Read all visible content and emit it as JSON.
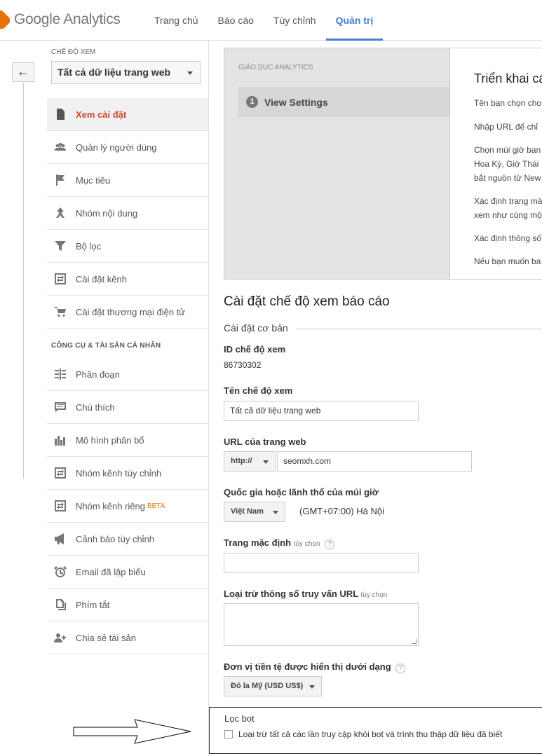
{
  "header": {
    "brand": "Google Analytics",
    "nav": [
      {
        "label": "Trang chủ",
        "active": false
      },
      {
        "label": "Báo cáo",
        "active": false
      },
      {
        "label": "Tùy chỉnh",
        "active": false
      },
      {
        "label": "Quản trị",
        "active": true
      }
    ]
  },
  "sidebar": {
    "view_label": "CHẾ ĐỘ XEM",
    "view_value": "Tất cả dữ liệu trang web",
    "items": [
      {
        "label": "Xem cài đặt",
        "icon": "document-icon",
        "active": true
      },
      {
        "label": "Quản lý người dùng",
        "icon": "users-icon"
      },
      {
        "label": "Mục tiêu",
        "icon": "flag-icon"
      },
      {
        "label": "Nhóm nội dung",
        "icon": "content-grouping-icon"
      },
      {
        "label": "Bộ lọc",
        "icon": "filter-icon"
      },
      {
        "label": "Cài đặt kênh",
        "icon": "channel-icon"
      },
      {
        "label": "Cài đặt thương mại điện tử",
        "icon": "cart-icon"
      }
    ],
    "section2_label": "CÔNG CỤ & TÀI SẢN CÁ NHÂN",
    "items2": [
      {
        "label": "Phân đoạn",
        "icon": "segments-icon"
      },
      {
        "label": "Chú thích",
        "icon": "annotation-icon"
      },
      {
        "label": "Mô hình phân bổ",
        "icon": "bar-chart-icon"
      },
      {
        "label": "Nhóm kênh tùy chỉnh",
        "icon": "channel-icon"
      },
      {
        "label": "Nhóm kênh riêng",
        "badge": "BETA",
        "icon": "channel-icon"
      },
      {
        "label": "Cảnh báo tùy chỉnh",
        "icon": "megaphone-icon"
      },
      {
        "label": "Email đã lập biểu",
        "icon": "alarm-clock-icon"
      },
      {
        "label": "Phím tắt",
        "icon": "copy-icon"
      },
      {
        "label": "Chia sẻ tài sản",
        "icon": "add-user-icon"
      }
    ]
  },
  "wizard": {
    "category": "GIÁO DỤC ANALYTICS",
    "step_number": "1",
    "step_label": "View Settings",
    "title": "Triển khai cá",
    "lines": [
      "Tên bạn chọn cho",
      "Nhập URL để chỉ",
      "Chọn múi giờ bạn",
      "Hoa Kỳ, Giờ Thái",
      "bắt nguồn từ New",
      "Xác định trang mà",
      "xem như cùng mộ",
      "Xác định thông số",
      "Nếu bạn muốn ba"
    ]
  },
  "settings": {
    "title": "Cài đặt chế độ xem báo cáo",
    "basic_heading": "Cài đặt cơ bản",
    "view_id_label": "ID chế độ xem",
    "view_id": "86730302",
    "view_name_label": "Tên chế độ xem",
    "view_name": "Tất cả dữ liệu trang web",
    "url_label": "URL của trang web",
    "url_protocol": "http://",
    "url_value": "seomxh.com",
    "tz_label": "Quốc gia hoặc lãnh thổ của múi giờ",
    "tz_country": "Việt Nam",
    "tz_value": "(GMT+07:00) Hà Nội",
    "default_page_label": "Trang mặc định",
    "optional": "tùy chọn",
    "exclude_label": "Loại trừ thông số truy vấn URL",
    "currency_label": "Đơn vị tiền tệ được hiển thị dưới dạng",
    "currency_value": "Đô la Mỹ (USD US$)",
    "help_glyph": "?",
    "bot_title": "Lọc bot",
    "bot_checkbox_label": "Loại trừ tất cả các lần truy cập khỏi bot và trình thu thập dữ liệu đã biết"
  },
  "colors": {
    "accent": "#4a7cd0",
    "active_item": "#d0442d",
    "beta": "#e37400"
  }
}
